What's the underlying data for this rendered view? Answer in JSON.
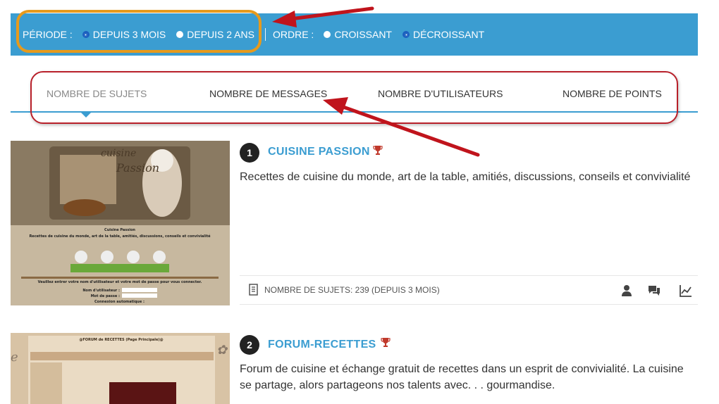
{
  "filter": {
    "periode_label": "PÉRIODE :",
    "periode_options": [
      "DEPUIS 3 MOIS",
      "DEPUIS 2 ANS"
    ],
    "ordre_label": "ORDRE :",
    "ordre_options": [
      "CROISSANT",
      "DÉCROISSANT"
    ]
  },
  "tabs": [
    {
      "label": "NOMBRE DE SUJETS"
    },
    {
      "label": "NOMBRE DE MESSAGES"
    },
    {
      "label": "NOMBRE D'UTILISATEURS"
    },
    {
      "label": "NOMBRE DE POINTS"
    }
  ],
  "results": [
    {
      "rank": "1",
      "title": "CUISINE PASSION",
      "description": "Recettes de cuisine du monde, art de la table, amitiés, discussions, conseils et convivialité",
      "stats": "NOMBRE DE SUJETS: 239 (DEPUIS 3 MOIS)",
      "thumb_caption": "Cuisine Passion",
      "thumb_sub": "Recettes de cuisine du monde, art de la table, amitiés, discussions, conseils et convivialité",
      "thumb_login": "Veuillez entrer votre nom d'utilisateur et votre mot de passe pour vous connecter.",
      "thumb_user": "Nom d'utilisateur :",
      "thumb_pass": "Mot de passe :",
      "thumb_auto": "Connexion automatique :"
    },
    {
      "rank": "2",
      "title": "FORUM-RECETTES",
      "description": "Forum de cuisine et échange gratuit de recettes dans un esprit de convivialité. La cuisine se partage, alors partageons nos talents avec. . . gourmandise.",
      "thumb_caption": "@FORUM de RECETTES (Page Principale)@"
    }
  ],
  "colors": {
    "accent": "#3b9dd1",
    "highlight_orange": "#e79a1c",
    "highlight_red": "#b8202a",
    "arrow_red": "#c0141c",
    "trophy": "#c0392b"
  }
}
